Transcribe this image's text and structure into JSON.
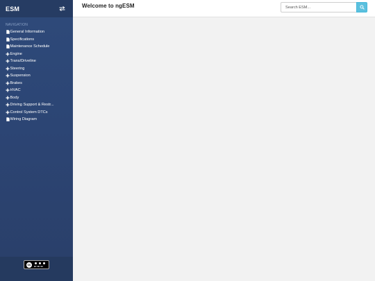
{
  "sidebar": {
    "brand": "ESM",
    "nav_caption": "NAVIGATION",
    "items": [
      {
        "label": "General Information",
        "icon": "document-icon"
      },
      {
        "label": "Specifications",
        "icon": "document-icon"
      },
      {
        "label": "Maintenance Schedule",
        "icon": "document-icon"
      },
      {
        "label": "Engine",
        "icon": "plus-icon"
      },
      {
        "label": "Trans/Driveline",
        "icon": "plus-icon"
      },
      {
        "label": "Steering",
        "icon": "plus-icon"
      },
      {
        "label": "Suspension",
        "icon": "plus-icon"
      },
      {
        "label": "Brakes",
        "icon": "plus-icon"
      },
      {
        "label": "HVAC",
        "icon": "plus-icon"
      },
      {
        "label": "Body",
        "icon": "plus-icon"
      },
      {
        "label": "Driving Support & Restr...",
        "icon": "plus-icon"
      },
      {
        "label": "Control System DTCs",
        "icon": "plus-icon"
      },
      {
        "label": "Wiring Diagram",
        "icon": "document-icon"
      }
    ],
    "footer": {
      "license_badge": "creative-commons-by-nc-sa-badge",
      "badge_mark": "cc",
      "badge_tags": [
        "BY",
        "NC",
        "SA"
      ]
    }
  },
  "header": {
    "title": "Welcome to ngESM",
    "search_placeholder": "Search ESM...",
    "search_value": ""
  },
  "colors": {
    "sidebar_bg": "#2c4574",
    "sidebar_header_bg": "#263c63",
    "accent": "#5bc0de",
    "content_bg": "#f2f2f2"
  }
}
